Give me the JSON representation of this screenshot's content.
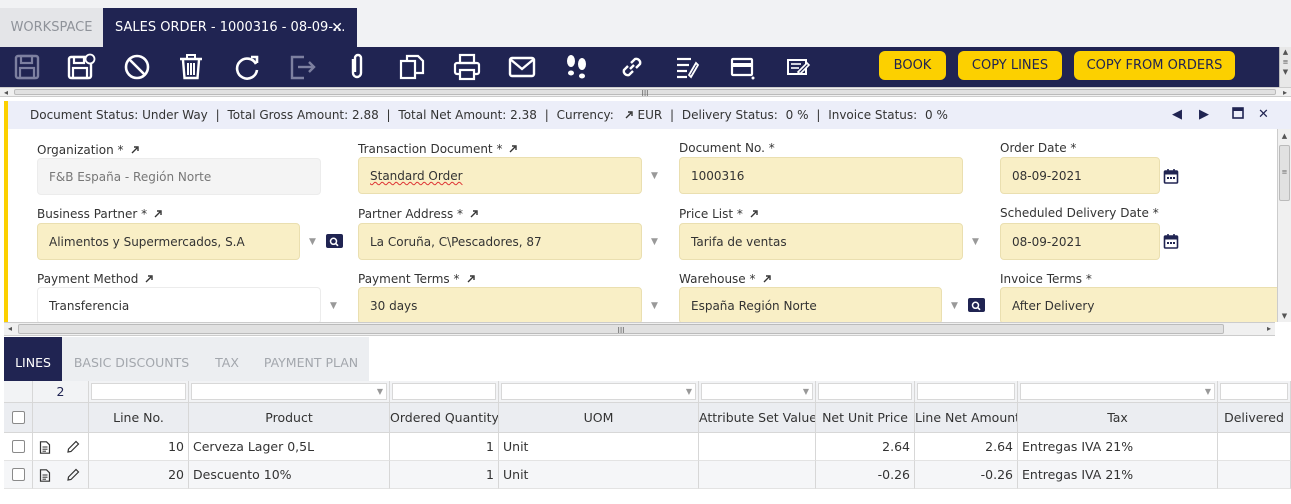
{
  "tabs": {
    "workspace": "WORKSPACE",
    "active": "SALES ORDER - 1000316 - 08-09-..."
  },
  "toolbar": {
    "book": "BOOK",
    "copy_lines": "COPY LINES",
    "copy_from_orders": "COPY FROM ORDERS"
  },
  "status": {
    "doc_status_label": "Document Status:",
    "doc_status": "Under Way",
    "gross_label": "Total Gross Amount:",
    "gross": "2.88",
    "net_label": "Total Net Amount:",
    "net": "2.38",
    "currency_label": "Currency:",
    "currency": "EUR",
    "delivery_label": "Delivery Status:",
    "delivery": "0 %",
    "invoice_label": "Invoice Status:",
    "invoice": "0 %",
    "sep": "|"
  },
  "form": {
    "organization": {
      "label": "Organization *",
      "value": "F&B España - Región Norte"
    },
    "transaction_document": {
      "label": "Transaction Document *",
      "value": "Standard Order"
    },
    "document_no": {
      "label": "Document No. *",
      "value": "1000316"
    },
    "order_date": {
      "label": "Order Date *",
      "value": "08-09-2021"
    },
    "business_partner": {
      "label": "Business Partner *",
      "value": "Alimentos y Supermercados, S.A"
    },
    "partner_address": {
      "label": "Partner Address *",
      "value": "La Coruña, C\\Pescadores, 87"
    },
    "price_list": {
      "label": "Price List *",
      "value": "Tarifa de ventas"
    },
    "scheduled_delivery_date": {
      "label": "Scheduled Delivery Date *",
      "value": "08-09-2021"
    },
    "payment_method": {
      "label": "Payment Method",
      "value": "Transferencia"
    },
    "payment_terms": {
      "label": "Payment Terms *",
      "value": "30 days"
    },
    "warehouse": {
      "label": "Warehouse *",
      "value": "España Región Norte"
    },
    "invoice_terms": {
      "label": "Invoice Terms *",
      "value": "After Delivery"
    }
  },
  "subtabs": [
    "LINES",
    "BASIC DISCOUNTS",
    "TAX",
    "PAYMENT PLAN"
  ],
  "grid": {
    "count": "2",
    "headers": [
      "Line No.",
      "Product",
      "Ordered Quantity",
      "UOM",
      "Attribute Set Value",
      "Net Unit Price",
      "Line Net Amount",
      "Tax",
      "Delivered"
    ],
    "rows": [
      {
        "line": "10",
        "product": "Cerveza Lager 0,5L",
        "qty": "1",
        "uom": "Unit",
        "attr": "",
        "price": "2.64",
        "amount": "2.64",
        "tax": "Entregas IVA 21%",
        "delivered": ""
      },
      {
        "line": "20",
        "product": "Descuento 10%",
        "qty": "1",
        "uom": "Unit",
        "attr": "",
        "price": "-0.26",
        "amount": "-0.26",
        "tax": "Entregas IVA 21%",
        "delivered": ""
      }
    ]
  },
  "scroll": {
    "grip": "III"
  },
  "colors": {
    "navy": "#202452",
    "yellow": "#fcd000",
    "field": "#f9efc6"
  }
}
